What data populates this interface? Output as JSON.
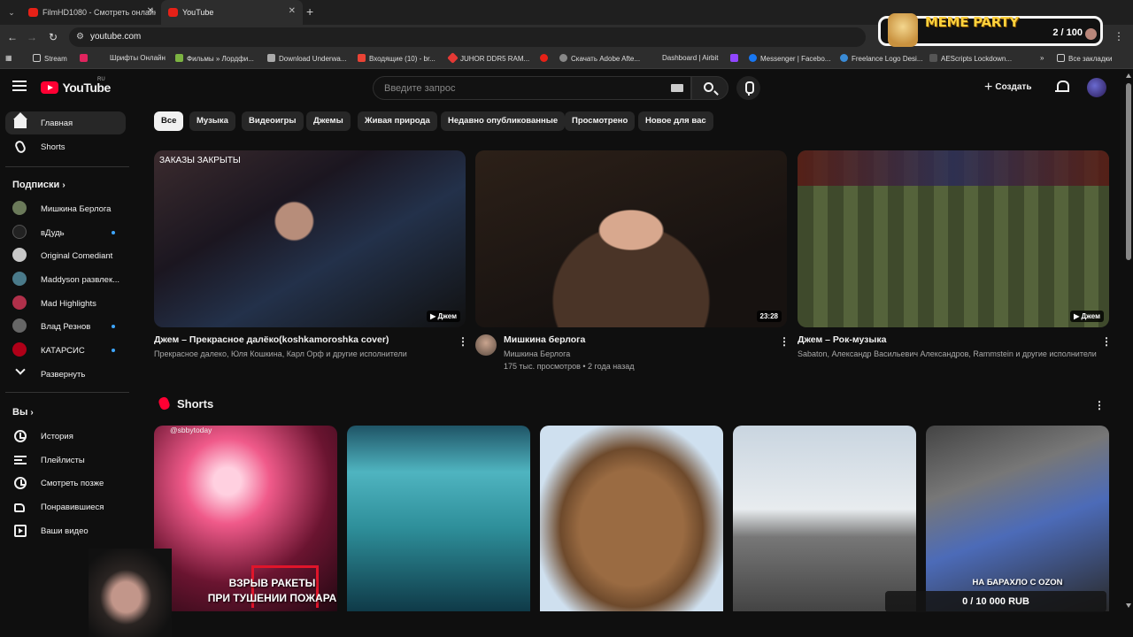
{
  "browser": {
    "tabs": [
      {
        "label": "FilmHD1080 - Смотреть онлайн"
      },
      {
        "label": "YouTube"
      }
    ],
    "address": "youtube.com",
    "bookmarks": [
      {
        "label": "Stream"
      },
      {
        "label": "Шрифты Онлайн"
      },
      {
        "label": "Фильмы » Лордфи..."
      },
      {
        "label": "Download Underwa..."
      },
      {
        "label": "Входящие (10) - br..."
      },
      {
        "label": "JUHOR DDR5 RAM..."
      },
      {
        "label": "Скачать Adobe Afte..."
      },
      {
        "label": "Dashboard | Airbit"
      },
      {
        "label": "Messenger | Facebo..."
      },
      {
        "label": "Freelance Logo Desi..."
      },
      {
        "label": "AEScripts Lockdown..."
      },
      {
        "label": "Все закладки"
      }
    ]
  },
  "meme_widget": {
    "title": "MEME PARTY",
    "count": "2 / 100"
  },
  "header": {
    "logo_word": "YouTube",
    "country": "RU",
    "search_placeholder": "Введите запрос",
    "create_label": "Создать"
  },
  "sidebar": {
    "main": [
      {
        "label": "Главная"
      },
      {
        "label": "Shorts"
      }
    ],
    "subscriptions_heading": "Подписки",
    "subscriptions": [
      {
        "label": "Мишкина Берлога",
        "color": "#6b7a5a"
      },
      {
        "label": "вДудь",
        "color": "#222222"
      },
      {
        "label": "Original Comediant",
        "color": "#c8c8c8"
      },
      {
        "label": "Maddyson развлек...",
        "color": "#4a7a8a"
      },
      {
        "label": "Mad Highlights",
        "color": "#b0304a"
      },
      {
        "label": "Влад Резнов",
        "color": "#666666"
      },
      {
        "label": "КАТАРСИС",
        "color": "#b00018"
      }
    ],
    "expand_label": "Развернуть",
    "you_heading": "Вы",
    "you_items": [
      {
        "label": "История"
      },
      {
        "label": "Плейлисты"
      },
      {
        "label": "Смотреть позже"
      },
      {
        "label": "Понравившиеся"
      },
      {
        "label": "Ваши видео"
      }
    ]
  },
  "chips": [
    "Все",
    "Музыка",
    "Видеоигры",
    "Джемы",
    "Живая природа",
    "Недавно опубликованные",
    "Просмотрено",
    "Новое для вас"
  ],
  "videos": [
    {
      "title": "Джем – Прекрасное далёко(koshkamoroshka cover)",
      "sub": "Прекрасное далеко, Юля Кошкина, Карл Орф и другие исполнители",
      "badge": "Джем",
      "overlay": "ЗАКАЗЫ ЗАКРЫТЫ"
    },
    {
      "title": "Мишкина берлога",
      "channel": "Мишкина Берлога",
      "stats": "175 тыс. просмотров • 2 года назад",
      "badge": "23:28"
    },
    {
      "title": "Джем – Рок-музыка",
      "sub": "Sabaton, Александр Васильевич Александров, Rammstein и другие исполнители",
      "badge": "Джем"
    }
  ],
  "shorts": {
    "heading": "Shorts",
    "items": [
      {
        "top": "@sbbytoday",
        "caption": "ВЗРЫВ РАКЕТЫ\nПРИ ТУШЕНИИ ПОЖАРА"
      },
      {
        "caption": ""
      },
      {
        "caption": ""
      },
      {
        "caption": ""
      },
      {
        "caption": "НА БАРАХЛО С OZON"
      }
    ]
  },
  "donation": "0 / 10 000 RUB"
}
